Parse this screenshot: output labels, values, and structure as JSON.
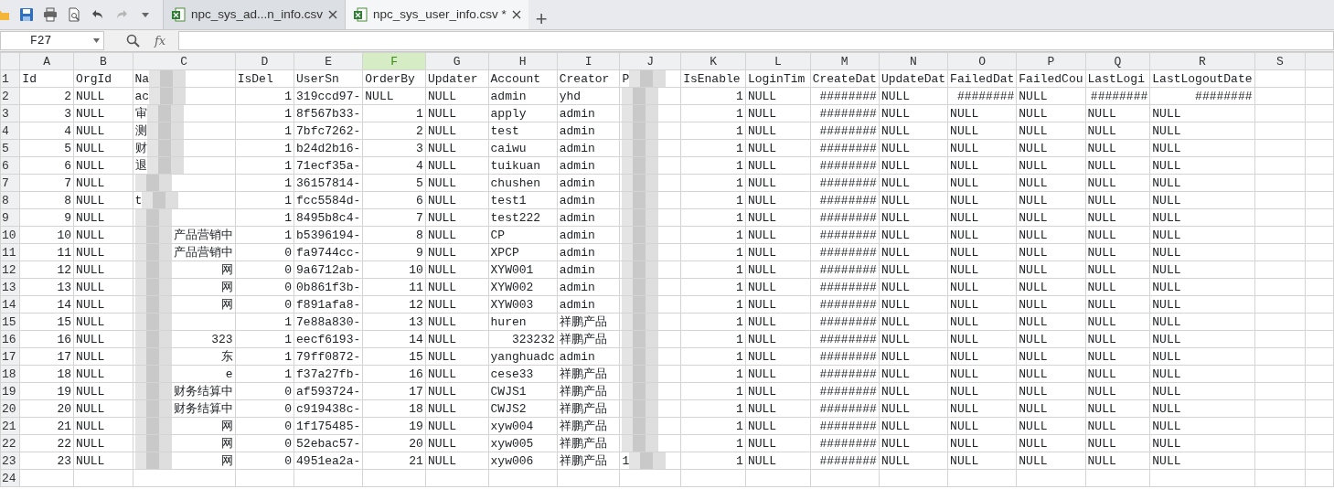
{
  "toolbar": {
    "buttons": [
      {
        "kind": "folder"
      },
      {
        "kind": "save"
      },
      {
        "kind": "print"
      },
      {
        "kind": "preview"
      },
      {
        "kind": "undo",
        "disabled": false
      },
      {
        "kind": "redo",
        "disabled": true
      },
      {
        "kind": "caret"
      }
    ]
  },
  "tabs": [
    {
      "label": "npc_sys_ad...n_info.csv",
      "selected": false
    },
    {
      "label": "npc_sys_user_info.csv *",
      "selected": true
    }
  ],
  "new_tab": "+",
  "formula_bar": {
    "name_box": "F27",
    "fx": "fx"
  },
  "sheet": {
    "columns": [
      {
        "letter": "A",
        "selected": false,
        "redacted": false
      },
      {
        "letter": "B",
        "selected": false,
        "redacted": false
      },
      {
        "letter": "C",
        "selected": false,
        "redacted": true
      },
      {
        "letter": "D",
        "selected": false,
        "redacted": false
      },
      {
        "letter": "E",
        "selected": false,
        "redacted": false
      },
      {
        "letter": "F",
        "selected": true,
        "redacted": false
      },
      {
        "letter": "G",
        "selected": false,
        "redacted": false
      },
      {
        "letter": "H",
        "selected": false,
        "redacted": false
      },
      {
        "letter": "I",
        "selected": false,
        "redacted": false
      },
      {
        "letter": "J",
        "selected": false,
        "redacted": true
      },
      {
        "letter": "K",
        "selected": false,
        "redacted": false
      },
      {
        "letter": "L",
        "selected": false,
        "redacted": false
      },
      {
        "letter": "M",
        "selected": false,
        "redacted": false
      },
      {
        "letter": "N",
        "selected": false,
        "redacted": false
      },
      {
        "letter": "O",
        "selected": false,
        "redacted": false
      },
      {
        "letter": "P",
        "selected": false,
        "redacted": false
      },
      {
        "letter": "Q",
        "selected": false,
        "redacted": false
      },
      {
        "letter": "R",
        "selected": false,
        "redacted": false
      },
      {
        "letter": "S",
        "selected": false,
        "redacted": false
      }
    ],
    "rows": [
      {
        "number": "1",
        "cells": [
          "Id",
          "OrgId",
          {
            "before": "Na"
          },
          "IsDel",
          "UserSn",
          "OrderBy",
          "Updater",
          "Account",
          "Creator",
          {
            "before": "P"
          },
          "IsEnable",
          "LoginTim",
          "CreateDat",
          "UpdateDat",
          "FailedDat",
          "FailedCou",
          "LastLogi",
          "LastLogoutDate",
          null
        ]
      },
      {
        "number": "2",
        "cells": [
          "2",
          "NULL",
          {
            "before": "ac"
          },
          "1",
          "319ccd97-",
          "NULL",
          "NULL",
          "admin",
          "yhd",
          {},
          "1",
          "NULL",
          "########",
          "NULL",
          "########",
          "NULL",
          "########",
          "########",
          null
        ]
      },
      {
        "number": "3",
        "cells": [
          "3",
          "NULL",
          {
            "before": "审"
          },
          "1",
          "8f567b33-",
          "1",
          "NULL",
          "apply",
          "admin",
          {},
          "1",
          "NULL",
          "########",
          "NULL",
          "NULL",
          "NULL",
          "NULL",
          "NULL",
          null
        ]
      },
      {
        "number": "4",
        "cells": [
          "4",
          "NULL",
          {
            "before": "测"
          },
          "1",
          "7bfc7262-",
          "2",
          "NULL",
          "test",
          "admin",
          {},
          "1",
          "NULL",
          "########",
          "NULL",
          "NULL",
          "NULL",
          "NULL",
          "NULL",
          null
        ]
      },
      {
        "number": "5",
        "cells": [
          "5",
          "NULL",
          {
            "before": "财"
          },
          "1",
          "b24d2b16-",
          "3",
          "NULL",
          "caiwu",
          "admin",
          {},
          "1",
          "NULL",
          "########",
          "NULL",
          "NULL",
          "NULL",
          "NULL",
          "NULL",
          null
        ]
      },
      {
        "number": "6",
        "cells": [
          "6",
          "NULL",
          {
            "before": "退"
          },
          "1",
          "71ecf35a-",
          "4",
          "NULL",
          "tuikuan",
          "admin",
          {},
          "1",
          "NULL",
          "########",
          "NULL",
          "NULL",
          "NULL",
          "NULL",
          "NULL",
          null
        ]
      },
      {
        "number": "7",
        "cells": [
          "7",
          "NULL",
          {},
          "1",
          "36157814-",
          "5",
          "NULL",
          "chushen",
          "admin",
          {},
          "1",
          "NULL",
          "########",
          "NULL",
          "NULL",
          "NULL",
          "NULL",
          "NULL",
          null
        ]
      },
      {
        "number": "8",
        "cells": [
          "8",
          "NULL",
          {
            "before": "t"
          },
          "1",
          "fcc5584d-",
          "6",
          "NULL",
          "test1",
          "admin",
          {},
          "1",
          "NULL",
          "########",
          "NULL",
          "NULL",
          "NULL",
          "NULL",
          "NULL",
          null
        ]
      },
      {
        "number": "9",
        "cells": [
          "9",
          "NULL",
          {},
          "1",
          "8495b8c4-",
          "7",
          "NULL",
          "test222",
          "admin",
          {},
          "1",
          "NULL",
          "########",
          "NULL",
          "NULL",
          "NULL",
          "NULL",
          "NULL",
          null
        ]
      },
      {
        "number": "10",
        "cells": [
          "10",
          "NULL",
          {
            "after": "产品营销中"
          },
          "1",
          "b5396194-",
          "8",
          "NULL",
          "CP",
          "admin",
          {},
          "1",
          "NULL",
          "########",
          "NULL",
          "NULL",
          "NULL",
          "NULL",
          "NULL",
          null
        ]
      },
      {
        "number": "11",
        "cells": [
          "11",
          "NULL",
          {
            "after": "产品营销中"
          },
          "0",
          "fa9744cc-",
          "9",
          "NULL",
          "XPCP",
          "admin",
          {},
          "1",
          "NULL",
          "########",
          "NULL",
          "NULL",
          "NULL",
          "NULL",
          "NULL",
          null
        ]
      },
      {
        "number": "12",
        "cells": [
          "12",
          "NULL",
          {
            "after": "网"
          },
          "0",
          "9a6712ab-",
          "10",
          "NULL",
          "XYW001",
          "admin",
          {},
          "1",
          "NULL",
          "########",
          "NULL",
          "NULL",
          "NULL",
          "NULL",
          "NULL",
          null
        ]
      },
      {
        "number": "13",
        "cells": [
          "13",
          "NULL",
          {
            "after": "网"
          },
          "0",
          "0b861f3b-",
          "11",
          "NULL",
          "XYW002",
          "admin",
          {},
          "1",
          "NULL",
          "########",
          "NULL",
          "NULL",
          "NULL",
          "NULL",
          "NULL",
          null
        ]
      },
      {
        "number": "14",
        "cells": [
          "14",
          "NULL",
          {
            "after": "网"
          },
          "0",
          "f891afa8-",
          "12",
          "NULL",
          "XYW003",
          "admin",
          {},
          "1",
          "NULL",
          "########",
          "NULL",
          "NULL",
          "NULL",
          "NULL",
          "NULL",
          null
        ]
      },
      {
        "number": "15",
        "cells": [
          "15",
          "NULL",
          {},
          "1",
          "7e88a830-",
          "13",
          "NULL",
          "huren",
          "祥鹏产品",
          {},
          "1",
          "NULL",
          "########",
          "NULL",
          "NULL",
          "NULL",
          "NULL",
          "NULL",
          null
        ]
      },
      {
        "number": "16",
        "cells": [
          "16",
          "NULL",
          {
            "after": "323"
          },
          "1",
          "eecf6193-",
          "14",
          "NULL",
          "323232",
          "祥鹏产品",
          {},
          "1",
          "NULL",
          "########",
          "NULL",
          "NULL",
          "NULL",
          "NULL",
          "NULL",
          null
        ]
      },
      {
        "number": "17",
        "cells": [
          "17",
          "NULL",
          {
            "after": "东"
          },
          "1",
          "79ff0872-",
          "15",
          "NULL",
          "yanghuadc",
          "admin",
          {},
          "1",
          "NULL",
          "########",
          "NULL",
          "NULL",
          "NULL",
          "NULL",
          "NULL",
          null
        ]
      },
      {
        "number": "18",
        "cells": [
          "18",
          "NULL",
          {
            "after": "e"
          },
          "1",
          "f37a27fb-",
          "16",
          "NULL",
          "cese33",
          "祥鹏产品",
          {},
          "1",
          "NULL",
          "########",
          "NULL",
          "NULL",
          "NULL",
          "NULL",
          "NULL",
          null
        ]
      },
      {
        "number": "19",
        "cells": [
          "19",
          "NULL",
          {
            "after": "财务结算中"
          },
          "0",
          "af593724-",
          "17",
          "NULL",
          "CWJS1",
          "祥鹏产品",
          {},
          "1",
          "NULL",
          "########",
          "NULL",
          "NULL",
          "NULL",
          "NULL",
          "NULL",
          null
        ]
      },
      {
        "number": "20",
        "cells": [
          "20",
          "NULL",
          {
            "after": "财务结算中"
          },
          "0",
          "c919438c-",
          "18",
          "NULL",
          "CWJS2",
          "祥鹏产品",
          {},
          "1",
          "NULL",
          "########",
          "NULL",
          "NULL",
          "NULL",
          "NULL",
          "NULL",
          null
        ]
      },
      {
        "number": "21",
        "cells": [
          "21",
          "NULL",
          {
            "after": "网"
          },
          "0",
          "1f175485-",
          "19",
          "NULL",
          "xyw004",
          "祥鹏产品",
          {},
          "1",
          "NULL",
          "########",
          "NULL",
          "NULL",
          "NULL",
          "NULL",
          "NULL",
          null
        ]
      },
      {
        "number": "22",
        "cells": [
          "22",
          "NULL",
          {
            "after": "网"
          },
          "0",
          "52ebac57-",
          "20",
          "NULL",
          "xyw005",
          "祥鹏产品",
          {},
          "1",
          "NULL",
          "########",
          "NULL",
          "NULL",
          "NULL",
          "NULL",
          "NULL",
          null
        ]
      },
      {
        "number": "23",
        "cells": [
          "23",
          "NULL",
          {
            "after": "网"
          },
          "0",
          "4951ea2a-",
          "21",
          "NULL",
          "xyw006",
          "祥鹏产品",
          {
            "before": "1"
          },
          "1",
          "NULL",
          "########",
          "NULL",
          "NULL",
          "NULL",
          "NULL",
          "NULL",
          null
        ]
      },
      {
        "number": "24",
        "cells": []
      }
    ]
  }
}
